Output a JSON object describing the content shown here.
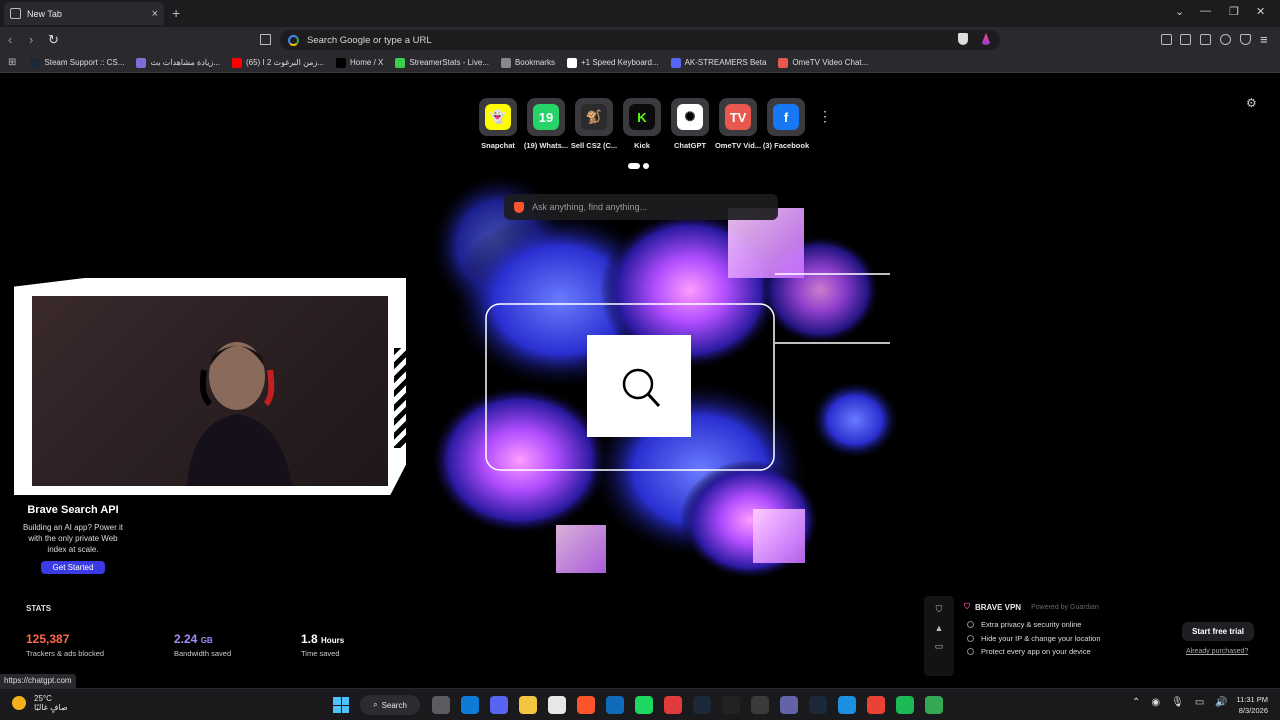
{
  "browser": {
    "tab_title": "New Tab",
    "new_tab_symbol": "+",
    "close_symbol": "×",
    "address_placeholder": "Search Google or type a URL"
  },
  "bookmarks": [
    {
      "label": "Steam Support :: CS...",
      "color": "#1b2838"
    },
    {
      "label": "زيادة مشاهدات بث...",
      "color": "#7b6fd6"
    },
    {
      "label": "(65) زمن البرغوث 2 ا...",
      "color": "#ff0000"
    },
    {
      "label": "Home / X",
      "color": "#000000"
    },
    {
      "label": "StreamerStats - Live...",
      "color": "#3ccf4e"
    },
    {
      "label": "Bookmarks",
      "color": "#888888"
    },
    {
      "label": "+1 Speed Keyboard...",
      "color": "#ffffff"
    },
    {
      "label": "AK-STREAMERS Beta",
      "color": "#5865f2"
    },
    {
      "label": "OmeTV Video Chat...",
      "color": "#e8584f"
    }
  ],
  "top_sites": [
    {
      "label": "Snapchat",
      "glyph": "👻",
      "bg": "#fffc00",
      "fg": "#000000"
    },
    {
      "label": "(19) Whats...",
      "glyph": "19",
      "bg": "#25d366",
      "fg": "#ffffff"
    },
    {
      "label": "Sell CS2 (C...",
      "glyph": "🐒",
      "bg": "#2b2b2e",
      "fg": "#ffffff"
    },
    {
      "label": "Kick",
      "glyph": "K",
      "bg": "#0b0b0b",
      "fg": "#53fc18"
    },
    {
      "label": "ChatGPT",
      "glyph": "✺",
      "bg": "#ffffff",
      "fg": "#000000"
    },
    {
      "label": "OmeTV Vid...",
      "glyph": "TV",
      "bg": "#e8584f",
      "fg": "#ffffff"
    },
    {
      "label": "(3) Facebook",
      "glyph": "f",
      "bg": "#1877f2",
      "fg": "#ffffff"
    }
  ],
  "search_box": {
    "placeholder": "Ask anything, find anything..."
  },
  "promo": {
    "title": "Brave Search API",
    "body": "Building an AI app? Power it with the only private Web index at scale.",
    "button": "Get Started"
  },
  "stats": {
    "heading": "STATS",
    "items": [
      {
        "value": "125,387",
        "unit": "",
        "label": "Trackers & ads blocked",
        "color": "#fb6a4a"
      },
      {
        "value": "2.24",
        "unit": "GB",
        "label": "Bandwidth saved",
        "color": "#a78bfa"
      },
      {
        "value": "1.8",
        "unit": "Hours",
        "label": "Time saved",
        "color": "#ffffff"
      }
    ]
  },
  "vpn": {
    "title": "BRAVE VPN",
    "powered_by": "Powered by Guardian",
    "features": [
      "Extra privacy & security online",
      "Hide your IP & change your location",
      "Protect every app on your device"
    ],
    "trial_button": "Start free trial",
    "already_link": "Already purchased?"
  },
  "status_url": "https://chatgpt.com",
  "taskbar": {
    "weather_temp": "25°C",
    "weather_text": "صافٍ غالبًا",
    "search_label": "Search",
    "time": "11:31 PM",
    "date": "8/3/2026",
    "apps": [
      "#5c5c60",
      "#0f7bd8",
      "#5865f2",
      "#f3c63f",
      "#e7e7e7",
      "#fb542b",
      "#0f6cbd",
      "#1ed760",
      "#e23b3b",
      "#1b2838",
      "#222222",
      "#3a3a3a",
      "#6264a7",
      "#1b2838",
      "#1d8fe1",
      "#ea4335",
      "#1db954",
      "#34a853"
    ]
  }
}
